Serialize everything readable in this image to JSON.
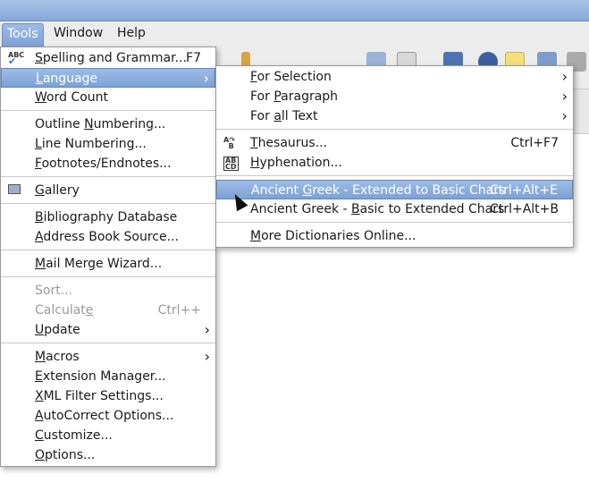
{
  "menubar": {
    "items": [
      "Tools",
      "Window",
      "Help"
    ],
    "active": "Tools"
  },
  "tools_menu": [
    {
      "label": "Spelling and Grammar...",
      "mn": 0,
      "shortcut": "F7",
      "icon": "spellcheck-icon"
    },
    {
      "label": "Language",
      "mn": 0,
      "submenu": true,
      "highlighted": true
    },
    {
      "label": "Word Count",
      "mn": 0
    },
    {
      "sep": true
    },
    {
      "label": "Outline Numbering...",
      "mn": 8
    },
    {
      "label": "Line Numbering...",
      "mn": 0
    },
    {
      "label": "Footnotes/Endnotes...",
      "mn": 0
    },
    {
      "sep": true
    },
    {
      "label": "Gallery",
      "mn": 0,
      "icon": "gallery-icon"
    },
    {
      "sep": true
    },
    {
      "label": "Bibliography Database",
      "mn": 0
    },
    {
      "label": "Address Book Source...",
      "mn": 0
    },
    {
      "sep": true
    },
    {
      "label": "Mail Merge Wizard...",
      "mn": 0
    },
    {
      "sep": true
    },
    {
      "label": "Sort...",
      "mn": -1,
      "disabled": true
    },
    {
      "label": "Calculate",
      "mn": 8,
      "shortcut": "Ctrl++",
      "disabled": true
    },
    {
      "label": "Update",
      "mn": 0,
      "submenu": true
    },
    {
      "sep": true
    },
    {
      "label": "Macros",
      "mn": 0,
      "submenu": true
    },
    {
      "label": "Extension Manager...",
      "mn": 0
    },
    {
      "label": "XML Filter Settings...",
      "mn": 0
    },
    {
      "label": "AutoCorrect Options...",
      "mn": 0
    },
    {
      "label": "Customize...",
      "mn": 0
    },
    {
      "label": "Options...",
      "mn": 0
    }
  ],
  "language_menu": [
    {
      "label": "For Selection",
      "mn": 0,
      "submenu": true
    },
    {
      "label": "For Paragraph",
      "mn": 4,
      "submenu": true
    },
    {
      "label": "For all Text",
      "mn": 4,
      "submenu": true
    },
    {
      "sep": true
    },
    {
      "label": "Thesaurus...",
      "mn": 0,
      "shortcut": "Ctrl+F7",
      "icon": "thesaurus-icon"
    },
    {
      "label": "Hyphenation...",
      "mn": 0,
      "icon": "hyphenation-icon"
    },
    {
      "sep": true
    },
    {
      "label": "Ancient Greek - Extended to Basic Chars",
      "mn": 8,
      "shortcut": "Ctrl+Alt+E",
      "highlighted": true
    },
    {
      "label": "Ancient Greek - Basic to Extended Chars",
      "mn": 16,
      "shortcut": "Ctrl+Alt+B"
    },
    {
      "sep": true
    },
    {
      "label": "More Dictionaries Online...",
      "mn": 0
    }
  ],
  "colors": {
    "highlight": "#7ea1d5",
    "titlebar": "#86a8d8"
  }
}
